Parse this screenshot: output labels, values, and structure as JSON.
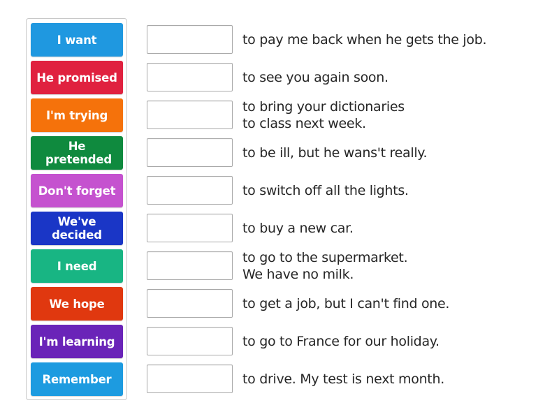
{
  "activity": {
    "tiles": [
      {
        "label": "I want",
        "color": "#1f98e0"
      },
      {
        "label": "He promised",
        "color": "#e0213f"
      },
      {
        "label": "I'm trying",
        "color": "#f5720b"
      },
      {
        "label": "He pretended",
        "color": "#0f8a3e"
      },
      {
        "label": "Don't forget",
        "color": "#c552cf"
      },
      {
        "label": "We've decided",
        "color": "#1a36c6"
      },
      {
        "label": "I need",
        "color": "#18b583"
      },
      {
        "label": "We hope",
        "color": "#e0380f"
      },
      {
        "label": "I'm learning",
        "color": "#6a24b8"
      },
      {
        "label": "Remember",
        "color": "#1d9be0"
      }
    ],
    "rows": [
      {
        "drop_value": "",
        "sentence": "to pay me back when he gets the job."
      },
      {
        "drop_value": "",
        "sentence": "to see you again soon."
      },
      {
        "drop_value": "",
        "sentence": "to bring your dictionaries\nto class next week."
      },
      {
        "drop_value": "",
        "sentence": "to be ill, but he wans't really."
      },
      {
        "drop_value": "",
        "sentence": "to switch off all the lights."
      },
      {
        "drop_value": "",
        "sentence": "to buy a new car."
      },
      {
        "drop_value": "",
        "sentence": "to go to the supermarket.\nWe have no milk."
      },
      {
        "drop_value": "",
        "sentence": "to get a job, but I can't find one."
      },
      {
        "drop_value": "",
        "sentence": "to go to France for our holiday."
      },
      {
        "drop_value": "",
        "sentence": "to drive. My test is next month."
      }
    ]
  }
}
